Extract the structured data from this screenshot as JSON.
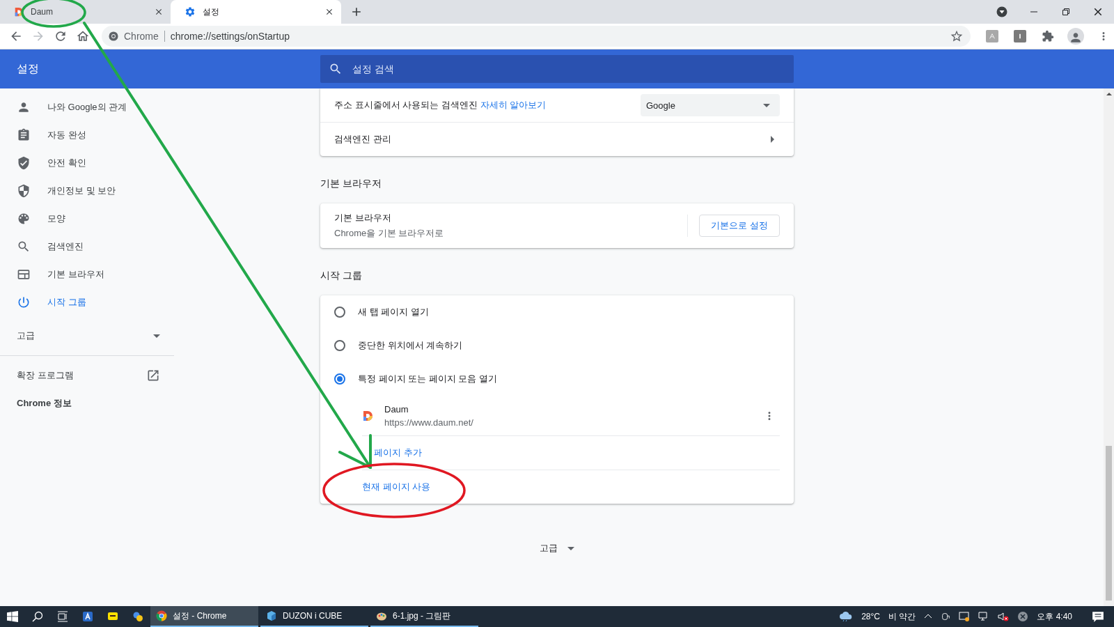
{
  "tabs": [
    {
      "title": "Daum",
      "selected": false
    },
    {
      "title": "설정",
      "selected": true
    }
  ],
  "address_bar": {
    "site_label": "Chrome",
    "url": "chrome://settings/onStartup"
  },
  "header": {
    "title": "설정",
    "search_placeholder": "설정 검색"
  },
  "sidebar": {
    "items": [
      {
        "label": "나와 Google의 관계",
        "selected": false
      },
      {
        "label": "자동 완성",
        "selected": false
      },
      {
        "label": "안전 확인",
        "selected": false
      },
      {
        "label": "개인정보 및 보안",
        "selected": false
      },
      {
        "label": "모양",
        "selected": false
      },
      {
        "label": "검색엔진",
        "selected": false
      },
      {
        "label": "기본 브라우저",
        "selected": false
      },
      {
        "label": "시작 그룹",
        "selected": true
      }
    ],
    "advanced": {
      "label": "고급",
      "expanded": false
    },
    "links": [
      {
        "label": "확장 프로그램",
        "external": true
      },
      {
        "label": "Chrome 정보",
        "external": false
      }
    ]
  },
  "search_engine_card": {
    "rows": [
      {
        "kind": "dropdown",
        "label": "주소 표시줄에서 사용되는 검색엔진",
        "link": "자세히 알아보기",
        "value": "Google"
      },
      {
        "kind": "submenu",
        "label": "검색엔진 관리"
      }
    ]
  },
  "default_browser": {
    "heading": "기본 브라우저",
    "title": "기본 브라우저",
    "subtitle": "Chrome을 기본 브라우저로",
    "button": "기본으로 설정"
  },
  "startup": {
    "heading": "시작 그룹",
    "options": [
      {
        "label": "새 탭 페이지 열기",
        "selected": false
      },
      {
        "label": "중단한 위치에서 계속하기",
        "selected": false
      },
      {
        "label": "특정 페이지 또는 페이지 모음 열기",
        "selected": true
      }
    ],
    "pages": [
      {
        "name": "Daum",
        "url": "https://www.daum.net/"
      }
    ],
    "actions": [
      "페이지 추가",
      "현재 페이지 사용"
    ]
  },
  "advanced_button": {
    "label": "고급"
  },
  "taskbar": {
    "apps": [
      {
        "label": "설정 - Chrome",
        "selected": true
      },
      {
        "label": "DUZON i CUBE",
        "selected": false
      },
      {
        "label": "6-1.jpg - 그림판",
        "selected": false
      }
    ],
    "temperature": "28°C",
    "weather": "비 약간",
    "clock": "오후 4:40"
  },
  "annotations": [
    {
      "kind": "ellipse",
      "color": "#22a84a"
    },
    {
      "kind": "arrow",
      "color": "#22a84a"
    },
    {
      "kind": "ellipse",
      "color": "#e01822"
    }
  ]
}
